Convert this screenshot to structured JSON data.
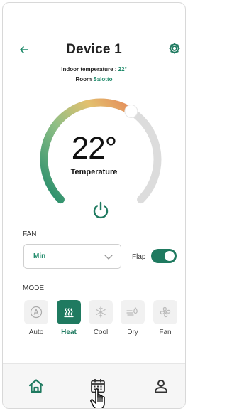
{
  "header": {
    "title": "Device 1",
    "back_icon": "arrow-left-icon",
    "settings_icon": "gear-icon"
  },
  "info": {
    "indoor_label": "Indoor temperature : ",
    "indoor_value": "22°",
    "room_label": "Room ",
    "room_value": "Salotto"
  },
  "thermostat": {
    "temperature": "22°",
    "label": "Temperature",
    "level_fraction": 0.62,
    "power_icon": "power-icon"
  },
  "fan": {
    "section_label": "FAN",
    "selected": "Min",
    "flap_label": "Flap",
    "flap_on": true
  },
  "mode": {
    "section_label": "MODE",
    "items": [
      {
        "label": "Auto",
        "icon": "auto-icon",
        "active": false
      },
      {
        "label": "Heat",
        "icon": "heat-icon",
        "active": true
      },
      {
        "label": "Cool",
        "icon": "snowflake-icon",
        "active": false
      },
      {
        "label": "Dry",
        "icon": "dry-icon",
        "active": false
      },
      {
        "label": "Fan",
        "icon": "fan-icon",
        "active": false
      }
    ]
  },
  "nav": {
    "items": [
      "home-icon",
      "calendar-icon",
      "user-icon"
    ]
  },
  "colors": {
    "accent": "#1f7a60",
    "accent_text": "#1f8a6a",
    "gradient_start": "#1f8a6a",
    "gradient_mid": "#d4c070",
    "gradient_end": "#e58a5a",
    "track": "#dcdcdc"
  }
}
